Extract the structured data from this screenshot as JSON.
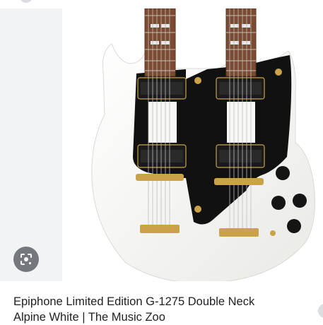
{
  "result": {
    "caption_line1": "Epiphone Limited Edition G-1275 Double Neck",
    "caption_line2": "Alpine White | The Music Zoo"
  },
  "image": {
    "subject_icon": "double-neck-guitar-image",
    "body_color": "#f7f7f5",
    "pickguard_color": "#111111",
    "hardware_color": "#c9a24a",
    "fretboard_color": "#7a4a33"
  },
  "controls": {
    "lens_icon": "visual-search-icon"
  }
}
